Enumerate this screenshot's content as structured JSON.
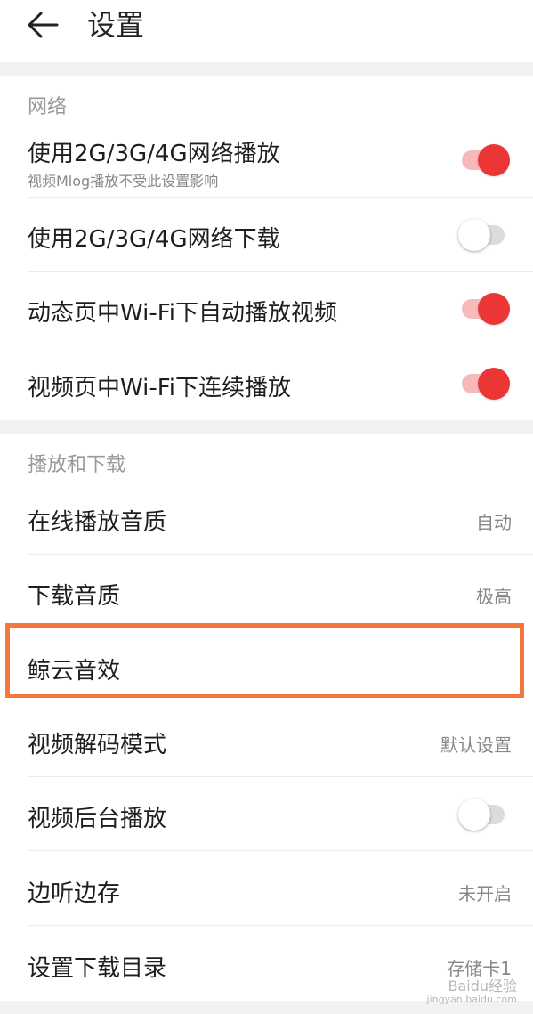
{
  "header": {
    "title": "设置"
  },
  "sections": {
    "network": {
      "label": "网络",
      "items": [
        {
          "title": "使用2G/3G/4G网络播放",
          "subtitle": "视频Mlog播放不受此设置影响",
          "toggle": "on"
        },
        {
          "title": "使用2G/3G/4G网络下载",
          "toggle": "off"
        },
        {
          "title": "动态页中Wi-Fi下自动播放视频",
          "toggle": "on"
        },
        {
          "title": "视频页中Wi-Fi下连续播放",
          "toggle": "on"
        }
      ]
    },
    "playback": {
      "label": "播放和下载",
      "items": [
        {
          "title": "在线播放音质",
          "value": "自动"
        },
        {
          "title": "下载音质",
          "value": "极高"
        },
        {
          "title": "鲸云音效"
        },
        {
          "title": "视频解码模式",
          "value": "默认设置"
        },
        {
          "title": "视频后台播放",
          "toggle": "off"
        },
        {
          "title": "边听边存",
          "value": "未开启"
        },
        {
          "title": "设置下载目录",
          "value": "存储卡1"
        }
      ]
    }
  },
  "colors": {
    "accent_red": "#ec3535",
    "highlight_orange": "#f4773d"
  },
  "watermark": {
    "text": "Baidu经验",
    "sub": "jingyan.baidu.com"
  }
}
